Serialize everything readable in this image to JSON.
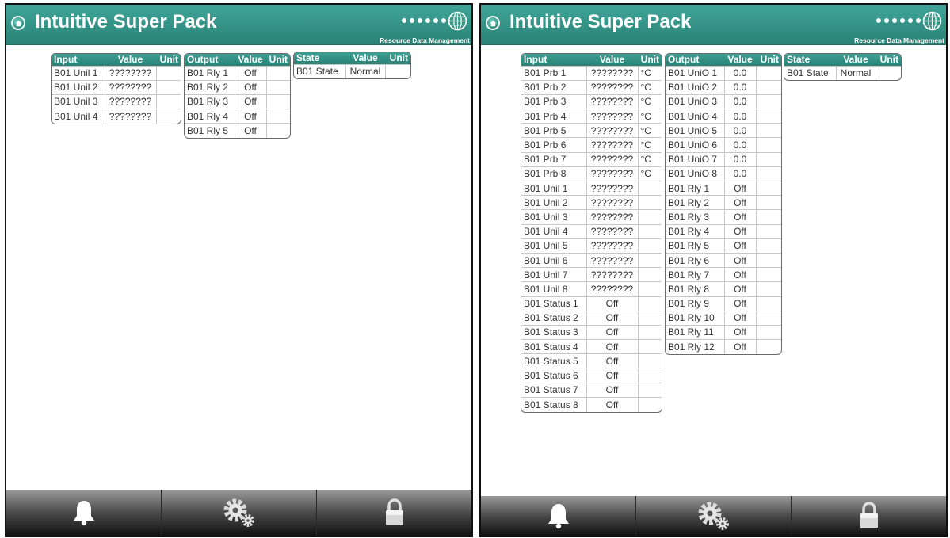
{
  "app": {
    "title": "Intuitive Super Pack",
    "logo_text": "Resource Data Management",
    "accent_color": "#2a8276"
  },
  "icons": {
    "home": "home-icon",
    "alarm": "bell-icon",
    "settings": "gears-icon",
    "lock": "padlock-icon"
  },
  "left": {
    "input": {
      "headers": [
        "Input",
        "Value",
        "Unit"
      ],
      "rows": [
        [
          "B01 Unil 1",
          "????????",
          ""
        ],
        [
          "B01 Unil 2",
          "????????",
          ""
        ],
        [
          "B01 Unil 3",
          "????????",
          ""
        ],
        [
          "B01 Unil 4",
          "????????",
          ""
        ]
      ]
    },
    "output": {
      "headers": [
        "Output",
        "Value",
        "Unit"
      ],
      "rows": [
        [
          "B01 Rly 1",
          "Off",
          ""
        ],
        [
          "B01 Rly 2",
          "Off",
          ""
        ],
        [
          "B01 Rly 3",
          "Off",
          ""
        ],
        [
          "B01 Rly 4",
          "Off",
          ""
        ],
        [
          "B01 Rly 5",
          "Off",
          ""
        ]
      ]
    },
    "state": {
      "headers": [
        "State",
        "Value",
        "Unit"
      ],
      "rows": [
        [
          "B01 State",
          "Normal",
          ""
        ]
      ]
    }
  },
  "right": {
    "input": {
      "headers": [
        "Input",
        "Value",
        "Unit"
      ],
      "rows": [
        [
          "B01 Prb 1",
          "????????",
          "°C"
        ],
        [
          "B01 Prb 2",
          "????????",
          "°C"
        ],
        [
          "B01 Prb 3",
          "????????",
          "°C"
        ],
        [
          "B01 Prb 4",
          "????????",
          "°C"
        ],
        [
          "B01 Prb 5",
          "????????",
          "°C"
        ],
        [
          "B01 Prb 6",
          "????????",
          "°C"
        ],
        [
          "B01 Prb 7",
          "????????",
          "°C"
        ],
        [
          "B01 Prb 8",
          "????????",
          "°C"
        ],
        [
          "B01 Unil 1",
          "????????",
          ""
        ],
        [
          "B01 Unil 2",
          "????????",
          ""
        ],
        [
          "B01 Unil 3",
          "????????",
          ""
        ],
        [
          "B01 Unil 4",
          "????????",
          ""
        ],
        [
          "B01 Unil 5",
          "????????",
          ""
        ],
        [
          "B01 Unil 6",
          "????????",
          ""
        ],
        [
          "B01 Unil 7",
          "????????",
          ""
        ],
        [
          "B01 Unil 8",
          "????????",
          ""
        ],
        [
          "B01 Status 1",
          "Off",
          ""
        ],
        [
          "B01 Status 2",
          "Off",
          ""
        ],
        [
          "B01 Status 3",
          "Off",
          ""
        ],
        [
          "B01 Status 4",
          "Off",
          ""
        ],
        [
          "B01 Status 5",
          "Off",
          ""
        ],
        [
          "B01 Status 6",
          "Off",
          ""
        ],
        [
          "B01 Status 7",
          "Off",
          ""
        ],
        [
          "B01 Status 8",
          "Off",
          ""
        ]
      ]
    },
    "output": {
      "headers": [
        "Output",
        "Value",
        "Unit"
      ],
      "rows": [
        [
          "B01 UniO 1",
          "0.0",
          ""
        ],
        [
          "B01 UniO 2",
          "0.0",
          ""
        ],
        [
          "B01 UniO 3",
          "0.0",
          ""
        ],
        [
          "B01 UniO 4",
          "0.0",
          ""
        ],
        [
          "B01 UniO 5",
          "0.0",
          ""
        ],
        [
          "B01 UniO 6",
          "0.0",
          ""
        ],
        [
          "B01 UniO 7",
          "0.0",
          ""
        ],
        [
          "B01 UniO 8",
          "0.0",
          ""
        ],
        [
          "B01 Rly 1",
          "Off",
          ""
        ],
        [
          "B01 Rly 2",
          "Off",
          ""
        ],
        [
          "B01 Rly 3",
          "Off",
          ""
        ],
        [
          "B01 Rly 4",
          "Off",
          ""
        ],
        [
          "B01 Rly 5",
          "Off",
          ""
        ],
        [
          "B01 Rly 6",
          "Off",
          ""
        ],
        [
          "B01 Rly 7",
          "Off",
          ""
        ],
        [
          "B01 Rly 8",
          "Off",
          ""
        ],
        [
          "B01 Rly 9",
          "Off",
          ""
        ],
        [
          "B01 Rly 10",
          "Off",
          ""
        ],
        [
          "B01 Rly 11",
          "Off",
          ""
        ],
        [
          "B01 Rly 12",
          "Off",
          ""
        ]
      ]
    },
    "state": {
      "headers": [
        "State",
        "Value",
        "Unit"
      ],
      "rows": [
        [
          "B01 State",
          "Normal",
          ""
        ]
      ]
    }
  }
}
